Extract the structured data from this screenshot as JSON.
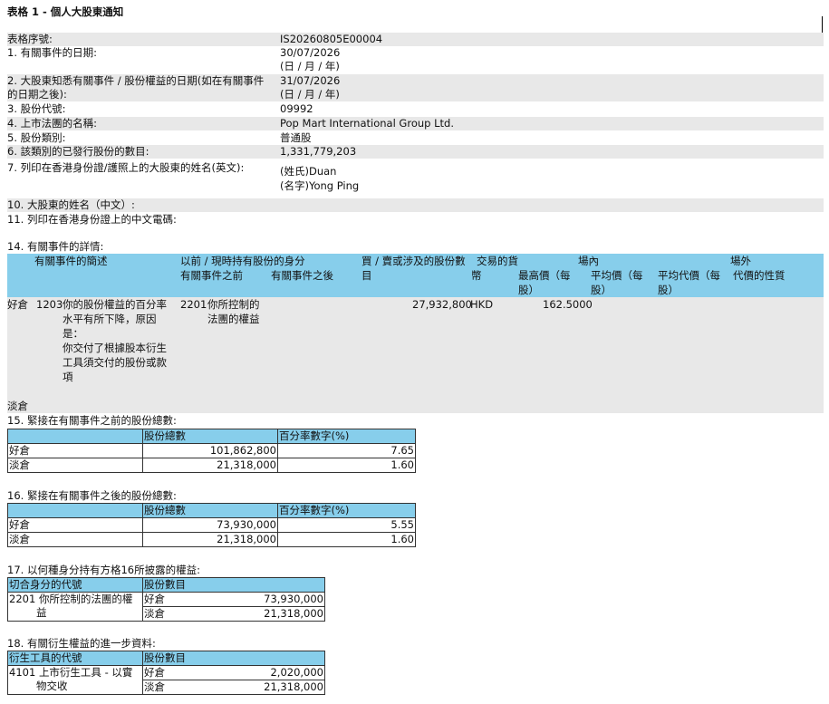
{
  "title": "表格 1 - 個人大股東通知",
  "fields": [
    {
      "label": "表格序號:",
      "value": "IS20260805E00004"
    },
    {
      "label": "1. 有關事件的日期:",
      "value": "30/07/2026",
      "note": "(日 / 月 / 年)"
    },
    {
      "label": "2. 大股東知悉有關事件 / 股份權益的日期(如在有關事件",
      "label2": "的日期之後):",
      "value": "31/07/2026",
      "note": "(日 / 月 / 年)"
    },
    {
      "label": "3. 股份代號:",
      "value": "09992"
    },
    {
      "label": "4. 上市法團的名稱:",
      "value": "Pop Mart International Group Ltd."
    },
    {
      "label": "5. 股份類別:",
      "value": "普通股"
    },
    {
      "label": "6. 該類別的已發行股份的數目:",
      "value": "1,331,779,203"
    },
    {
      "label": "7. 列印在香港身份證/護照上的大股東的姓名(英文):",
      "value": "(姓氏)Duan",
      "value2": "(名字)Yong Ping"
    },
    {
      "label": "10. 大股東的姓名（中文）:"
    },
    {
      "label": "11. 列印在香港身份證上的中文電碼:"
    }
  ],
  "section14": {
    "heading": "14. 有關事件的詳情:",
    "headers": {
      "event_code": "有關事件的簡述",
      "capacity": "以前 / 現時持有股份的身分",
      "before": "有關事件之前",
      "after": "有關事件之後",
      "shares": "買 / 賣或涉及的股份數",
      "currency1": "交易的貨",
      "currency2": "幣",
      "onexch": "場內",
      "high": "最高價（每",
      "high2": "股）",
      "avg": "平均價（每",
      "avg2": "股）",
      "offexch": "場外",
      "avg_off": "平均代價（每",
      "avg_off2": "股）",
      "nature": "代價的性質"
    },
    "row": {
      "position": "好倉",
      "code": "1203",
      "desc_lines": [
        "你的股份權益的百分率",
        "水平有所下降，原因",
        "是：",
        "你交付了根據股本衍生",
        "工具須交付的股份或款",
        "項"
      ],
      "cap_code": "2201",
      "cap_lines": [
        "你所控制的",
        "法團的權益"
      ],
      "shares": "27,932,800",
      "currency": "HKD",
      "high": "162.5000"
    },
    "short_label": "淡倉"
  },
  "section15": {
    "heading": "15. 緊接在有關事件之前的股份總數:",
    "col_shares": "股份總數",
    "col_pct": "百分率數字(%)",
    "rows": [
      {
        "label": "好倉",
        "shares": "101,862,800",
        "pct": "7.65"
      },
      {
        "label": "淡倉",
        "shares": "21,318,000",
        "pct": "1.60"
      }
    ]
  },
  "section16": {
    "heading": "16. 緊接在有關事件之後的股份總數:",
    "col_shares": "股份總數",
    "col_pct": "百分率數字(%)",
    "rows": [
      {
        "label": "好倉",
        "shares": "73,930,000",
        "pct": "5.55"
      },
      {
        "label": "淡倉",
        "shares": "21,318,000",
        "pct": "1.60"
      }
    ]
  },
  "section17": {
    "heading": "17. 以何種身分持有方格16所披露的權益:",
    "col_code": "切合身分的代號",
    "col_shares": "股份數目",
    "code": "2201",
    "desc": "你所控制的法團的權",
    "desc2": "益",
    "rows": [
      {
        "label": "好倉",
        "shares": "73,930,000"
      },
      {
        "label": "淡倉",
        "shares": "21,318,000"
      }
    ]
  },
  "section18": {
    "heading": "18. 有關衍生權益的進一步資料:",
    "col_code": "衍生工具的代號",
    "col_shares": "股份數目",
    "code": "4101",
    "desc": "上市衍生工具 - 以實",
    "desc2": "物交收",
    "rows": [
      {
        "label": "好倉",
        "shares": "2,020,000"
      },
      {
        "label": "淡倉",
        "shares": "21,318,000"
      }
    ]
  }
}
